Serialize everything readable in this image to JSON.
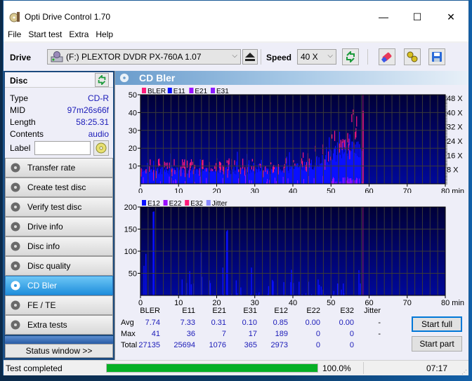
{
  "window": {
    "title": "Opti Drive Control 1.70",
    "controls": {
      "minimize": "—",
      "maximize": "☐",
      "close": "✕"
    }
  },
  "menu": [
    "File",
    "Start test",
    "Extra",
    "Help"
  ],
  "toolbar": {
    "drive_label": "Drive",
    "drive_value": "(F:)  PLEXTOR DVDR  PX-760A 1.07",
    "speed_label": "Speed",
    "speed_value": "40 X"
  },
  "disc": {
    "heading": "Disc",
    "fields": [
      {
        "label": "Type",
        "value": "CD-R"
      },
      {
        "label": "MID",
        "value": "97m26s66f"
      },
      {
        "label": "Length",
        "value": "58:25.31"
      },
      {
        "label": "Contents",
        "value": "audio"
      }
    ],
    "label_label": "Label",
    "label_value": ""
  },
  "nav": [
    {
      "label": "Transfer rate",
      "active": false
    },
    {
      "label": "Create test disc",
      "active": false
    },
    {
      "label": "Verify test disc",
      "active": false
    },
    {
      "label": "Drive info",
      "active": false
    },
    {
      "label": "Disc info",
      "active": false
    },
    {
      "label": "Disc quality",
      "active": false
    },
    {
      "label": "CD Bler",
      "active": true
    },
    {
      "label": "FE / TE",
      "active": false
    },
    {
      "label": "Extra tests",
      "active": false
    }
  ],
  "status_window_label": "Status window >>",
  "main": {
    "heading": "CD Bler"
  },
  "chart_data": [
    {
      "type": "bar",
      "title": "",
      "legend": [
        "BLER",
        "E11",
        "E21",
        "E31"
      ],
      "legend_colors": [
        "#ff1a7a",
        "#0a10ff",
        "#9a10ff",
        "#8a1aff"
      ],
      "xlabel": "min",
      "x_ticks": [
        "0",
        "10",
        "20",
        "30",
        "40",
        "50",
        "60",
        "70",
        "80 min"
      ],
      "xlim": [
        0,
        80
      ],
      "ylim": [
        0,
        50
      ],
      "y_ticks": [
        "10",
        "20",
        "30",
        "40",
        "50"
      ],
      "y2_ticks": [
        "8 X",
        "16 X",
        "24 X",
        "32 X",
        "40 X",
        "48 X"
      ],
      "data_end_min": 58.4,
      "series": [
        {
          "name": "E11",
          "profile": [
            [
              0,
              8
            ],
            [
              5,
              8
            ],
            [
              10,
              8
            ],
            [
              20,
              8
            ],
            [
              30,
              8
            ],
            [
              40,
              9
            ],
            [
              45,
              12
            ],
            [
              50,
              17
            ],
            [
              53,
              22
            ],
            [
              55,
              20
            ],
            [
              58,
              20
            ]
          ]
        },
        {
          "name": "BLER",
          "profile": [
            [
              0,
              9
            ],
            [
              5,
              9
            ],
            [
              10,
              9
            ],
            [
              20,
              9
            ],
            [
              30,
              9
            ],
            [
              40,
              10
            ],
            [
              45,
              13
            ],
            [
              50,
              19
            ],
            [
              53,
              26
            ],
            [
              55,
              23
            ],
            [
              58.4,
              41
            ]
          ]
        }
      ]
    },
    {
      "type": "bar",
      "legend": [
        "E12",
        "E22",
        "E32",
        "Jitter"
      ],
      "legend_colors": [
        "#0a10ff",
        "#9a10ff",
        "#ff1a7a",
        "#8888ff"
      ],
      "xlabel": "min",
      "x_ticks": [
        "0",
        "10",
        "20",
        "30",
        "40",
        "50",
        "60",
        "70",
        "80 min"
      ],
      "xlim": [
        0,
        80
      ],
      "ylim": [
        0,
        200
      ],
      "y_ticks": [
        "50",
        "100",
        "150",
        "200"
      ],
      "data_end_min": 58.4,
      "series": [
        {
          "name": "E12",
          "spikes": [
            [
              0.8,
              67
            ],
            [
              1.3,
              94
            ],
            [
              3.2,
              189
            ],
            [
              3.4,
              190
            ],
            [
              10.8,
              36
            ],
            [
              12,
              28
            ],
            [
              12.8,
              55
            ],
            [
              13.2,
              25
            ],
            [
              13.8,
              27
            ],
            [
              15.8,
              97
            ],
            [
              16,
              42
            ],
            [
              18,
              34
            ],
            [
              18.2,
              28
            ],
            [
              21.5,
              63
            ],
            [
              22.5,
              145
            ],
            [
              22.7,
              148
            ],
            [
              25,
              34
            ],
            [
              26.2,
              18
            ],
            [
              29,
              63
            ],
            [
              31,
              7
            ],
            [
              33.5,
              21
            ],
            [
              34.5,
              35
            ],
            [
              34.7,
              32
            ],
            [
              37.5,
              30
            ],
            [
              39.3,
              30
            ],
            [
              39.5,
              58
            ],
            [
              40,
              28
            ],
            [
              41.5,
              31
            ],
            [
              44,
              31
            ],
            [
              46.5,
              36
            ],
            [
              46.8,
              24
            ],
            [
              47.3,
              20
            ],
            [
              47.8,
              13
            ],
            [
              50.6,
              10
            ],
            [
              51.6,
              27
            ],
            [
              51.8,
              27
            ],
            [
              52.6,
              13
            ],
            [
              53.1,
              27
            ],
            [
              57.2,
              57
            ],
            [
              57.6,
              27
            ]
          ]
        }
      ]
    }
  ],
  "stats": {
    "columns": [
      "BLER",
      "E11",
      "E21",
      "E31",
      "E12",
      "E22",
      "E32",
      "Jitter"
    ],
    "rows": [
      {
        "label": "Avg",
        "values": [
          "7.74",
          "7.33",
          "0.31",
          "0.10",
          "0.85",
          "0.00",
          "0.00",
          "-"
        ]
      },
      {
        "label": "Max",
        "values": [
          "41",
          "36",
          "7",
          "17",
          "189",
          "0",
          "0",
          "-"
        ]
      },
      {
        "label": "Total",
        "values": [
          "27135",
          "25694",
          "1076",
          "365",
          "2973",
          "0",
          "0",
          ""
        ]
      }
    ]
  },
  "buttons": {
    "start_full": "Start full",
    "start_part": "Start part"
  },
  "statusbar": {
    "status_text": "Test completed",
    "progress_percent": 100.0,
    "progress_text": "100.0%",
    "elapsed": "07:17"
  }
}
